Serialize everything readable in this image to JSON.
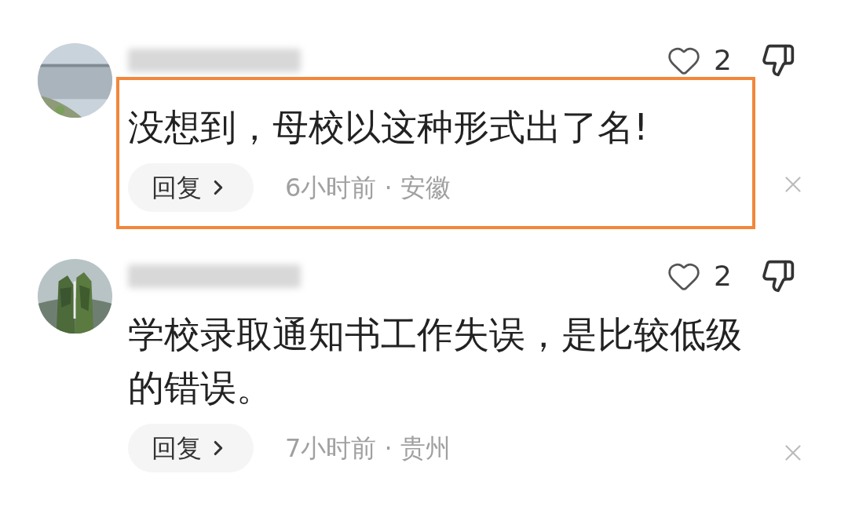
{
  "comments": [
    {
      "highlighted": true,
      "likes": "2",
      "text": "没想到，母校以这种形式出了名!",
      "reply": "回复",
      "meta": "6小时前 · 安徽"
    },
    {
      "highlighted": false,
      "likes": "2",
      "text": "学校录取通知书工作失误，是比较低级的错误。",
      "reply": "回复",
      "meta": "7小时前 · 贵州"
    }
  ]
}
